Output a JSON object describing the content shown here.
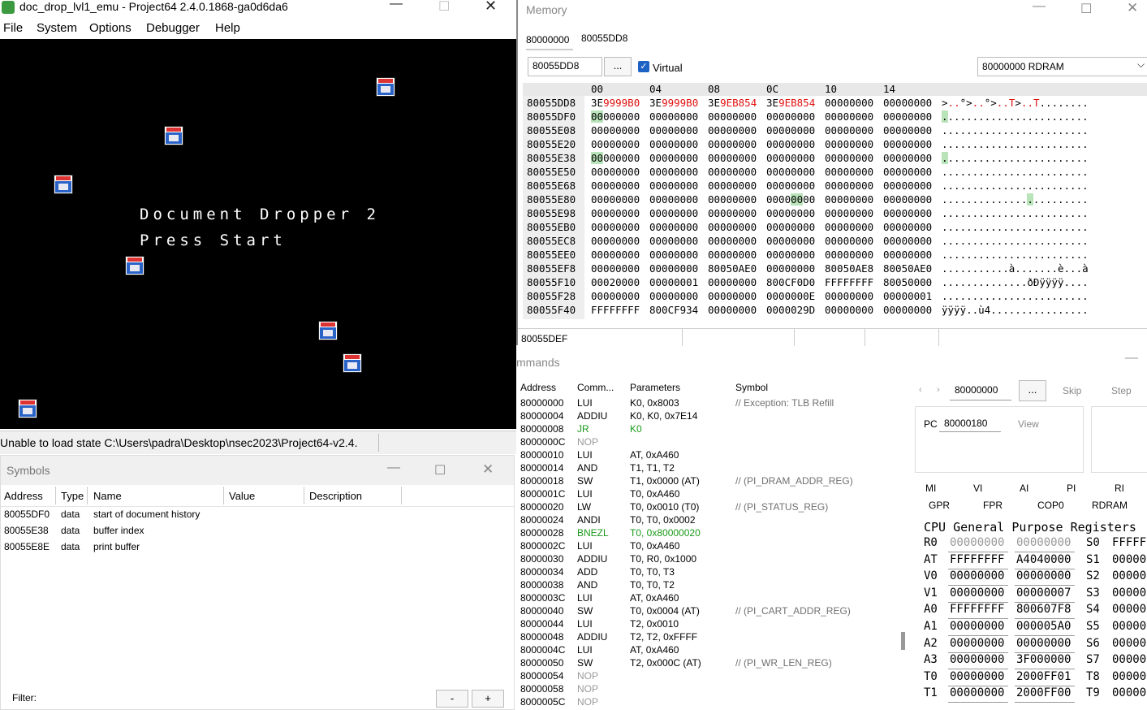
{
  "emulator": {
    "title": "doc_drop_lvl1_emu - Project64 2.4.0.1868-ga0d6da6",
    "menu": [
      "File",
      "System",
      "Options",
      "Debugger",
      "Help"
    ],
    "game_title": "Document Dropper 2",
    "game_prompt": "Press Start",
    "status": "Unable to load state C:\\Users\\padra\\Desktop\\nsec2023\\Project64-v2.4."
  },
  "symbols": {
    "title": "Symbols",
    "columns": [
      "Address",
      "Type",
      "Name",
      "Value",
      "Description"
    ],
    "rows": [
      {
        "address": "80055DF0",
        "type": "data",
        "name": "start of document history"
      },
      {
        "address": "80055E38",
        "type": "data",
        "name": "buffer index"
      },
      {
        "address": "80055E8E",
        "type": "data",
        "name": "print buffer"
      }
    ],
    "filter_label": "Filter:",
    "minus": "-",
    "plus": "+"
  },
  "memory": {
    "title": "Memory",
    "tabs": [
      "80000000",
      "80055DD8"
    ],
    "address_input": "80055DD8",
    "browse_label": "...",
    "virtual_label": "Virtual",
    "region_select": "80000000 RDRAM",
    "column_headers": [
      "00",
      "04",
      "08",
      "0C",
      "10",
      "14"
    ],
    "rows": [
      {
        "addr": "80055DD8",
        "ascii": ">..°>..°>..T>..T........"
      },
      {
        "addr": "80055DF0",
        "w": [
          "00000000",
          "00000000",
          "00000000",
          "00000000",
          "00000000",
          "00000000"
        ],
        "ascii": "........................"
      },
      {
        "addr": "80055E08",
        "w": [
          "00000000",
          "00000000",
          "00000000",
          "00000000",
          "00000000",
          "00000000"
        ],
        "ascii": "........................"
      },
      {
        "addr": "80055E20",
        "w": [
          "00000000",
          "00000000",
          "00000000",
          "00000000",
          "00000000",
          "00000000"
        ],
        "ascii": "........................"
      },
      {
        "addr": "80055E38",
        "w": [
          "00000000",
          "00000000",
          "00000000",
          "00000000",
          "00000000",
          "00000000"
        ],
        "ascii": "........................"
      },
      {
        "addr": "80055E50",
        "w": [
          "00000000",
          "00000000",
          "00000000",
          "00000000",
          "00000000",
          "00000000"
        ],
        "ascii": "........................"
      },
      {
        "addr": "80055E68",
        "w": [
          "00000000",
          "00000000",
          "00000000",
          "00000000",
          "00000000",
          "00000000"
        ],
        "ascii": "........................"
      },
      {
        "addr": "80055E80",
        "w": [
          "00000000",
          "00000000",
          "00000000",
          "00000000",
          "00000000",
          "00000000"
        ],
        "ascii": "........................"
      },
      {
        "addr": "80055E98",
        "w": [
          "00000000",
          "00000000",
          "00000000",
          "00000000",
          "00000000",
          "00000000"
        ],
        "ascii": "........................"
      },
      {
        "addr": "80055EB0",
        "w": [
          "00000000",
          "00000000",
          "00000000",
          "00000000",
          "00000000",
          "00000000"
        ],
        "ascii": "........................"
      },
      {
        "addr": "80055EC8",
        "w": [
          "00000000",
          "00000000",
          "00000000",
          "00000000",
          "00000000",
          "00000000"
        ],
        "ascii": "........................"
      },
      {
        "addr": "80055EE0",
        "w": [
          "00000000",
          "00000000",
          "00000000",
          "00000000",
          "00000000",
          "00000000"
        ],
        "ascii": "........................"
      },
      {
        "addr": "80055EF8",
        "w": [
          "00000000",
          "00000000",
          "80050AE0",
          "00000000",
          "80050AE8",
          "80050AE0"
        ],
        "ascii": "...........à.......è...à"
      },
      {
        "addr": "80055F10",
        "w": [
          "00020000",
          "00000001",
          "00000000",
          "800CF0D0",
          "FFFFFFFF",
          "80050000"
        ],
        "ascii": "..............ðÐÿÿÿÿ...."
      },
      {
        "addr": "80055F28",
        "w": [
          "00000000",
          "00000000",
          "00000000",
          "0000000E",
          "00000000",
          "00000001"
        ],
        "ascii": "........................"
      },
      {
        "addr": "80055F40",
        "w": [
          "FFFFFFFF",
          "800CF934",
          "00000000",
          "0000029D",
          "00000000",
          "00000000"
        ],
        "ascii": "ÿÿÿÿ..ù4................"
      }
    ],
    "row0_words": [
      [
        "3E",
        "9999B0"
      ],
      [
        "3E",
        "9999B0"
      ],
      [
        "3E",
        "9EB854"
      ],
      [
        "3E",
        "9EB854"
      ],
      [
        "",
        "00000000"
      ],
      [
        "",
        "00000000"
      ]
    ],
    "status_addr": "80055DEF"
  },
  "commands": {
    "title": "mmands",
    "columns": [
      "Address",
      "Comm...",
      "Parameters",
      "Symbol"
    ],
    "rows": [
      {
        "a": "80000000",
        "c": "LUI",
        "p": "K0, 0x8003",
        "s": "// Exception: TLB Refill",
        "k": "n"
      },
      {
        "a": "80000004",
        "c": "ADDIU",
        "p": "K0, K0, 0x7E14",
        "s": "",
        "k": "n"
      },
      {
        "a": "80000008",
        "c": "JR",
        "p": "K0",
        "s": "",
        "k": "g"
      },
      {
        "a": "8000000C",
        "c": "NOP",
        "p": "",
        "s": "",
        "k": "x"
      },
      {
        "a": "80000010",
        "c": "LUI",
        "p": "AT, 0xA460",
        "s": "",
        "k": "n"
      },
      {
        "a": "80000014",
        "c": "AND",
        "p": "T1, T1, T2",
        "s": "",
        "k": "n"
      },
      {
        "a": "80000018",
        "c": "SW",
        "p": "T1, 0x0000 (AT)",
        "s": "// (PI_DRAM_ADDR_REG)",
        "k": "n"
      },
      {
        "a": "8000001C",
        "c": "LUI",
        "p": "T0, 0xA460",
        "s": "",
        "k": "n"
      },
      {
        "a": "80000020",
        "c": "LW",
        "p": "T0, 0x0010 (T0)",
        "s": "// (PI_STATUS_REG)",
        "k": "n"
      },
      {
        "a": "80000024",
        "c": "ANDI",
        "p": "T0, T0, 0x0002",
        "s": "",
        "k": "n"
      },
      {
        "a": "80000028",
        "c": "BNEZL",
        "p": "T0, 0x80000020",
        "s": "",
        "k": "g"
      },
      {
        "a": "8000002C",
        "c": "LUI",
        "p": "T0, 0xA460",
        "s": "",
        "k": "n"
      },
      {
        "a": "80000030",
        "c": "ADDIU",
        "p": "T0, R0, 0x1000",
        "s": "",
        "k": "n"
      },
      {
        "a": "80000034",
        "c": "ADD",
        "p": "T0, T0, T3",
        "s": "",
        "k": "n"
      },
      {
        "a": "80000038",
        "c": "AND",
        "p": "T0, T0, T2",
        "s": "",
        "k": "n"
      },
      {
        "a": "8000003C",
        "c": "LUI",
        "p": "AT, 0xA460",
        "s": "",
        "k": "n"
      },
      {
        "a": "80000040",
        "c": "SW",
        "p": "T0, 0x0004 (AT)",
        "s": "// (PI_CART_ADDR_REG)",
        "k": "n"
      },
      {
        "a": "80000044",
        "c": "LUI",
        "p": "T2, 0x0010",
        "s": "",
        "k": "n"
      },
      {
        "a": "80000048",
        "c": "ADDIU",
        "p": "T2, T2, 0xFFFF",
        "s": "",
        "k": "n"
      },
      {
        "a": "8000004C",
        "c": "LUI",
        "p": "AT, 0xA460",
        "s": "",
        "k": "n"
      },
      {
        "a": "80000050",
        "c": "SW",
        "p": "T2, 0x000C (AT)",
        "s": "// (PI_WR_LEN_REG)",
        "k": "n"
      },
      {
        "a": "80000054",
        "c": "NOP",
        "p": "",
        "s": "",
        "k": "x"
      },
      {
        "a": "80000058",
        "c": "NOP",
        "p": "",
        "s": "",
        "k": "x"
      },
      {
        "a": "8000005C",
        "c": "NOP",
        "p": "",
        "s": "",
        "k": "x"
      }
    ],
    "goto_address": "80000000",
    "goto_browse": "...",
    "skip": "Skip",
    "step": "Step",
    "pc_label": "PC",
    "pc_value": "80000180",
    "view_label": "View",
    "reg_tabs_row1": [
      "MI",
      "VI",
      "AI",
      "PI",
      "RI"
    ],
    "reg_tabs_row2": [
      "GPR",
      "FPR",
      "COP0",
      "RDRAM"
    ],
    "gpr_title": "CPU General Purpose Registers",
    "registers": [
      {
        "n": "R0",
        "hi": "00000000",
        "lo": "00000000",
        "n2": "S0",
        "v2": "FFFFF",
        "grey": true
      },
      {
        "n": "AT",
        "hi": "FFFFFFFF",
        "lo": "A4040000",
        "n2": "S1",
        "v2": "00000"
      },
      {
        "n": "V0",
        "hi": "00000000",
        "lo": "00000000",
        "n2": "S2",
        "v2": "00000"
      },
      {
        "n": "V1",
        "hi": "00000000",
        "lo": "00000007",
        "n2": "S3",
        "v2": "00000"
      },
      {
        "n": "A0",
        "hi": "FFFFFFFF",
        "lo": "800607F8",
        "n2": "S4",
        "v2": "00000"
      },
      {
        "n": "A1",
        "hi": "00000000",
        "lo": "000005A0",
        "n2": "S5",
        "v2": "00000"
      },
      {
        "n": "A2",
        "hi": "00000000",
        "lo": "00000000",
        "n2": "S6",
        "v2": "00000"
      },
      {
        "n": "A3",
        "hi": "00000000",
        "lo": "3F000000",
        "n2": "S7",
        "v2": "00000"
      },
      {
        "n": "T0",
        "hi": "00000000",
        "lo": "2000FF01",
        "n2": "T8",
        "v2": "00000"
      },
      {
        "n": "T1",
        "hi": "00000000",
        "lo": "2000FF00",
        "n2": "T9",
        "v2": "00000"
      }
    ]
  }
}
